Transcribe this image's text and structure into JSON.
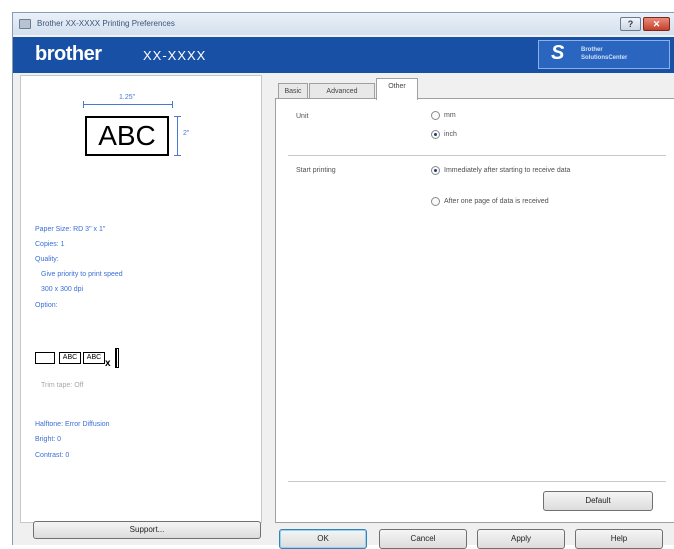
{
  "window": {
    "title": "Brother XX-XXXX Printing Preferences",
    "help_glyph": "?",
    "close_glyph": "✕"
  },
  "banner": {
    "brand": "brother",
    "model": "XX-XXXX",
    "solutions_logo": "S",
    "solutions_line1": "Brother",
    "solutions_line2": "SolutionsCenter"
  },
  "preview": {
    "label_text": "ABC",
    "width_label": "1.25\"",
    "height_label": "2\""
  },
  "info": {
    "paper_size": "Paper Size: RD 3\" x 1\"",
    "copies": "Copies: 1",
    "quality": "Quality:",
    "quality_value": "Give priority to print speed",
    "resolution": "300 x 300 dpi",
    "option": "Option:",
    "opt_abc1": "ABC",
    "opt_abc2": "ABC",
    "opt_x": "x",
    "trim_tape": "Trim tape: Off",
    "halftone": "Halftone: Error Diffusion",
    "bright": "Bright: 0",
    "contrast": "Contrast: 0"
  },
  "support_button": "Support...",
  "tabs": [
    {
      "label": "Basic"
    },
    {
      "label": "Advanced"
    },
    {
      "label": "Other"
    }
  ],
  "other_tab": {
    "unit_label": "Unit",
    "unit_options": [
      "mm",
      "inch"
    ],
    "unit_selected": "inch",
    "start_printing_label": "Start printing",
    "start_options": [
      "Immediately after starting to receive data",
      "After one page of data is received"
    ],
    "start_selected": "Immediately after starting to receive data",
    "default_button": "Default"
  },
  "footer": {
    "ok": "OK",
    "cancel": "Cancel",
    "apply": "Apply",
    "help": "Help"
  },
  "colors": {
    "banner": "#1850a6",
    "info_text": "#3a6fd6",
    "dimension": "#4a79d3"
  }
}
